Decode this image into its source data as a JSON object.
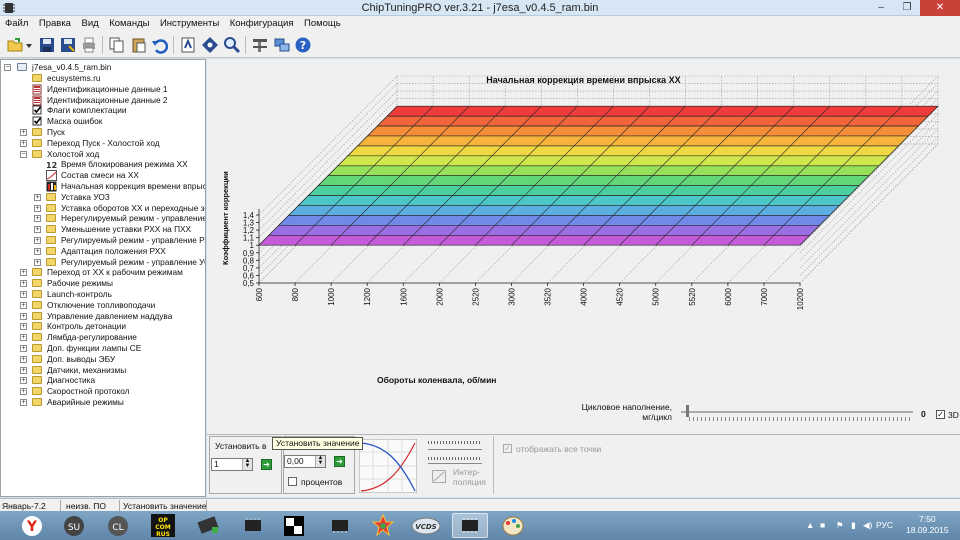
{
  "window": {
    "title": "ChipTuningPRO ver.3.21 - j7esa_v0.4.5_ram.bin",
    "minimize": "‒",
    "maximize": "❐",
    "close": "✕"
  },
  "menu": [
    "Файл",
    "Правка",
    "Вид",
    "Команды",
    "Инструменты",
    "Конфигурация",
    "Помощь"
  ],
  "toolbar_icons": [
    "open-icon",
    "dropdown-arrow-icon",
    "save-icon",
    "save-as-icon",
    "print-icon",
    "copy-icon",
    "paste-icon",
    "undo-icon",
    "script-icon",
    "info-icon",
    "search-icon",
    "tools-icon",
    "sync-icon",
    "help-icon"
  ],
  "tree": {
    "root": "j7esa_v0.4.5_ram.bin",
    "items": [
      {
        "label": "ecusystems.ru",
        "icon": "folder-icon"
      },
      {
        "label": "Идентификационные данные 1",
        "icon": "id-data-icon"
      },
      {
        "label": "Идентификационные данные 2",
        "icon": "id-data-icon"
      },
      {
        "label": "Флаги комплектации",
        "icon": "checkbox-flag-icon"
      },
      {
        "label": "Маска ошибок",
        "icon": "checkbox-flag-icon"
      },
      {
        "label": "Пуск",
        "icon": "folder-icon"
      },
      {
        "label": "Переход Пуск - Холостой ход",
        "icon": "folder-icon"
      },
      {
        "label": "Холостой ход",
        "icon": "folder-icon"
      },
      {
        "label": "Время блокирования режима ХХ",
        "icon": "constant-icon"
      },
      {
        "label": "Состав смеси на ХХ",
        "icon": "curve-icon"
      },
      {
        "label": "Начальная коррекция времени впрыска",
        "icon": "table-icon"
      },
      {
        "label": "Уставка УОЗ",
        "icon": "folder-icon"
      },
      {
        "label": "Уставка оборотов ХХ и переходные зоны",
        "icon": "folder-icon"
      },
      {
        "label": "Нерегулируемый режим - управление РХХ",
        "icon": "folder-icon"
      },
      {
        "label": "Уменьшение уставки РХХ на ПХХ",
        "icon": "folder-icon"
      },
      {
        "label": "Регулируемый режим - управление РХХ",
        "icon": "folder-icon"
      },
      {
        "label": "Адаптация положения РХХ",
        "icon": "folder-icon"
      },
      {
        "label": "Регулируемый режим - управление УОЗ",
        "icon": "folder-icon"
      },
      {
        "label": "Переход от ХХ к рабочим режимам",
        "icon": "folder-icon"
      },
      {
        "label": "Рабочие режимы",
        "icon": "folder-icon"
      },
      {
        "label": "Launch-контроль",
        "icon": "folder-icon"
      },
      {
        "label": "Отключение топливоподачи",
        "icon": "folder-icon"
      },
      {
        "label": "Управление давлением наддува",
        "icon": "folder-icon"
      },
      {
        "label": "Контроль детонации",
        "icon": "folder-icon"
      },
      {
        "label": "Лямбда-регулирование",
        "icon": "folder-icon"
      },
      {
        "label": "Доп. функции лампы CE",
        "icon": "folder-icon"
      },
      {
        "label": "Доп. выводы ЭБУ",
        "icon": "folder-icon"
      },
      {
        "label": "Датчики, механизмы",
        "icon": "folder-icon"
      },
      {
        "label": "Диагностика",
        "icon": "folder-icon"
      },
      {
        "label": "Скоростной протокол",
        "icon": "folder-icon"
      },
      {
        "label": "Аварийные режимы",
        "icon": "folder-icon"
      }
    ]
  },
  "chart_data": {
    "type": "surface3d",
    "title": "Начальная коррекция времени впрыска ХХ",
    "xlabel": "Обороты коленвала, об/мин",
    "ylabel": "Коэффициент коррекции",
    "x": [
      "600",
      "800",
      "1000",
      "1200",
      "1600",
      "2000",
      "2520",
      "3000",
      "3520",
      "4000",
      "4520",
      "5000",
      "5520",
      "6000",
      "7000",
      "10200"
    ],
    "yticks": [
      "0,5",
      "0,6",
      "0,7",
      "0,8",
      "0,9",
      "1",
      "1,1",
      "1,2",
      "1,3",
      "1,4"
    ],
    "ylim": [
      0.5,
      1.4
    ],
    "surface_value": 1.0,
    "rows": 14,
    "colors": [
      "#ee3b3b",
      "#f2653a",
      "#f58d39",
      "#f6b43c",
      "#f0d843",
      "#cfe64d",
      "#97e05a",
      "#62d678",
      "#4ccf9f",
      "#4dc6c7",
      "#5aaee0",
      "#6f8ae8",
      "#9870e4",
      "#c45bd8"
    ],
    "grid": true
  },
  "controls": {
    "cyclic_fill_label_1": "Цикловое наполнение,",
    "cyclic_fill_label_2": "мг/цикл",
    "cyclic_fill_value": "0",
    "label_3d": "3D",
    "set_in_label": "Установить в",
    "set_in_value": "1",
    "set_value_tooltip": "Установить значение",
    "value_input": "0,00",
    "percent_label": "процентов",
    "interp_label_1": "Интер-",
    "interp_label_2": "поляция",
    "show_all_points": "отображать все точки"
  },
  "status": {
    "left": "Январь-7.2",
    "middle": "неизв. ПО",
    "right": "Установить значение"
  },
  "taskbar": {
    "apps": [
      "browser-yandex-icon",
      "app-su-icon",
      "app-cl-icon",
      "app-opcomrus-icon",
      "chip-green-icon",
      "chip-black-icon",
      "app-checker-icon",
      "chip-icon",
      "app-mmc-icon",
      "app-star-icon",
      "app-vcds-icon",
      "chiptuningpro-icon",
      "paint-icon"
    ],
    "lang": "РУС",
    "time": "7:50",
    "date": "18.09.2015"
  }
}
